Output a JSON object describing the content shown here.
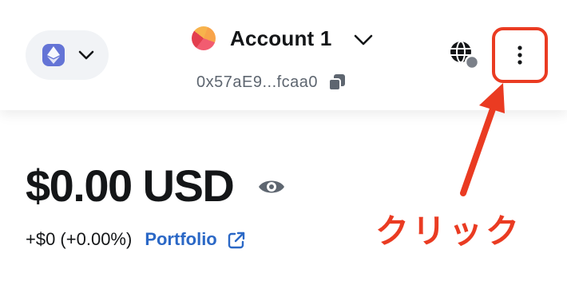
{
  "header": {
    "network": {
      "icon": "ethereum-icon",
      "chevron_icon": "chevron-down-icon"
    },
    "account": {
      "name": "Account 1",
      "avatar_icon": "jazzicon-avatar",
      "address": "0x57aE9...fcaa0",
      "copy_icon": "copy-icon"
    },
    "connected_sites_icon": "globe-icon",
    "menu_icon": "vertical-dots-icon"
  },
  "balance": {
    "amount": "$0.00",
    "currency": "USD",
    "visibility_icon": "eye-icon",
    "change": "+$0 (+0.00%)",
    "portfolio_label": "Portfolio",
    "portfolio_icon": "external-link-icon"
  },
  "annotation": {
    "label": "クリック",
    "color": "#ea3b22"
  },
  "colors": {
    "accent": "#2b68c6",
    "annotation": "#ea3b22",
    "network_badge": "#6474d6"
  }
}
